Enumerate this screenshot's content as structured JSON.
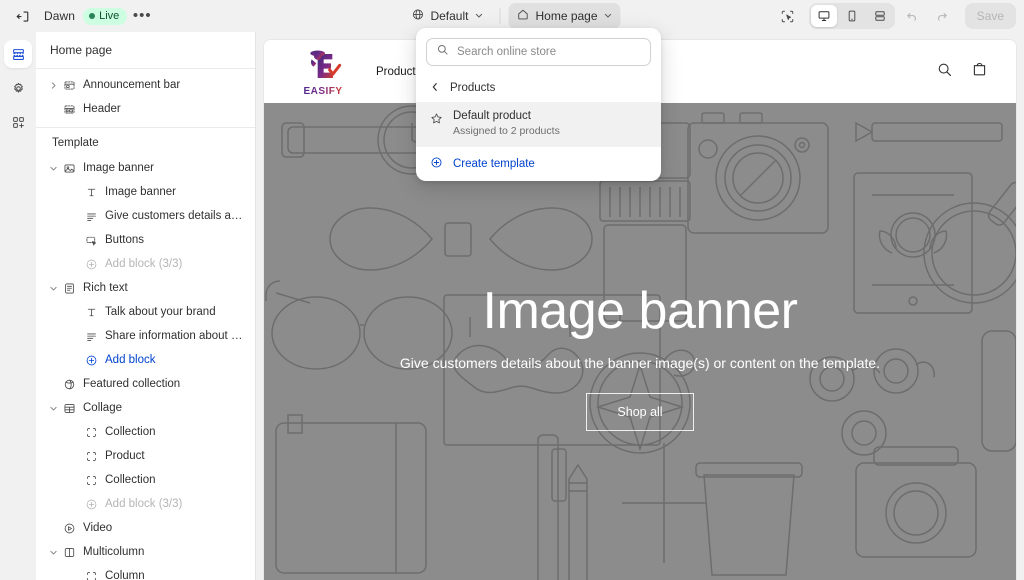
{
  "topbar": {
    "exit_icon": "exit-icon",
    "shop_name": "Dawn",
    "status_badge": "Live",
    "more_label": "•••",
    "theme_icon": "globe-icon",
    "theme_selector": "Default",
    "page_icon": "home-icon",
    "page_selector": "Home page",
    "inspector_icon": "inspector-icon",
    "device_desktop_icon": "desktop-icon",
    "device_mobile_icon": "mobile-icon",
    "device_fullwidth_icon": "fullwidth-icon",
    "undo_icon": "undo-icon",
    "redo_icon": "redo-icon",
    "save_label": "Save"
  },
  "rail": {
    "items": [
      {
        "name": "sections-icon",
        "label": "Sections",
        "active": true
      },
      {
        "name": "gear-icon",
        "label": "Theme settings",
        "active": false
      },
      {
        "name": "apps-icon",
        "label": "Apps",
        "active": false
      }
    ]
  },
  "sidebar": {
    "title": "Home page",
    "template_label": "Template",
    "header_group": [
      {
        "label": "Announcement bar",
        "icon": "announcement-icon",
        "chevron": "right",
        "level": "section"
      },
      {
        "label": "Header",
        "icon": "header-icon",
        "chevron": "none",
        "level": "section"
      }
    ],
    "template_group": [
      {
        "label": "Image banner",
        "icon": "image-icon",
        "chevron": "down",
        "level": "section"
      },
      {
        "label": "Image banner",
        "icon": "text-icon",
        "chevron": "none",
        "level": "block"
      },
      {
        "label": "Give customers details about t...",
        "icon": "paragraph-icon",
        "chevron": "none",
        "level": "block"
      },
      {
        "label": "Buttons",
        "icon": "button-icon",
        "chevron": "none",
        "level": "block"
      },
      {
        "label": "Add block (3/3)",
        "icon": "plus-circle-icon",
        "chevron": "none",
        "level": "block",
        "style": "add-muted"
      },
      {
        "label": "Rich text",
        "icon": "richtext-icon",
        "chevron": "down",
        "level": "section"
      },
      {
        "label": "Talk about your brand",
        "icon": "text-icon",
        "chevron": "none",
        "level": "block"
      },
      {
        "label": "Share information about your ...",
        "icon": "paragraph-icon",
        "chevron": "none",
        "level": "block"
      },
      {
        "label": "Add block",
        "icon": "plus-circle-icon",
        "chevron": "none",
        "level": "block",
        "style": "add-link"
      },
      {
        "label": "Featured collection",
        "icon": "collection-icon",
        "chevron": "none",
        "level": "section-nochev"
      },
      {
        "label": "Collage",
        "icon": "collage-icon",
        "chevron": "down",
        "level": "section"
      },
      {
        "label": "Collection",
        "icon": "block-icon",
        "chevron": "none",
        "level": "block"
      },
      {
        "label": "Product",
        "icon": "block-icon",
        "chevron": "none",
        "level": "block"
      },
      {
        "label": "Collection",
        "icon": "block-icon",
        "chevron": "none",
        "level": "block"
      },
      {
        "label": "Add block (3/3)",
        "icon": "plus-circle-icon",
        "chevron": "none",
        "level": "block",
        "style": "add-muted"
      },
      {
        "label": "Video",
        "icon": "video-icon",
        "chevron": "none",
        "level": "section-nochev"
      },
      {
        "label": "Multicolumn",
        "icon": "multicolumn-icon",
        "chevron": "down",
        "level": "section"
      },
      {
        "label": "Column",
        "icon": "block-icon",
        "chevron": "none",
        "level": "block"
      }
    ]
  },
  "popover": {
    "search_placeholder": "Search online store",
    "search_value": "",
    "search_icon": "search-icon",
    "back_icon": "chevron-left-icon",
    "header_label": "Products",
    "item_icon": "star-icon",
    "item_title": "Default product",
    "item_subtitle": "Assigned to 2 products",
    "create_icon": "plus-circle-icon",
    "create_label": "Create template"
  },
  "store": {
    "logo_word": "EASIFY",
    "logo_icon": "easify-logo-icon",
    "nav": [
      "Products"
    ],
    "search_icon": "search-icon",
    "cart_icon": "shopping-bag-icon",
    "banner_title": "Image banner",
    "banner_subtitle": "Give customers details about the banner image(s) or content on the template.",
    "banner_button": "Shop all"
  },
  "colors": {
    "accent_blue": "#0043ce",
    "live_badge_bg": "#cdfee1",
    "live_badge_text": "#0c5132",
    "chrome_bg": "#f1f1f1",
    "banner_gray": "#969696"
  }
}
